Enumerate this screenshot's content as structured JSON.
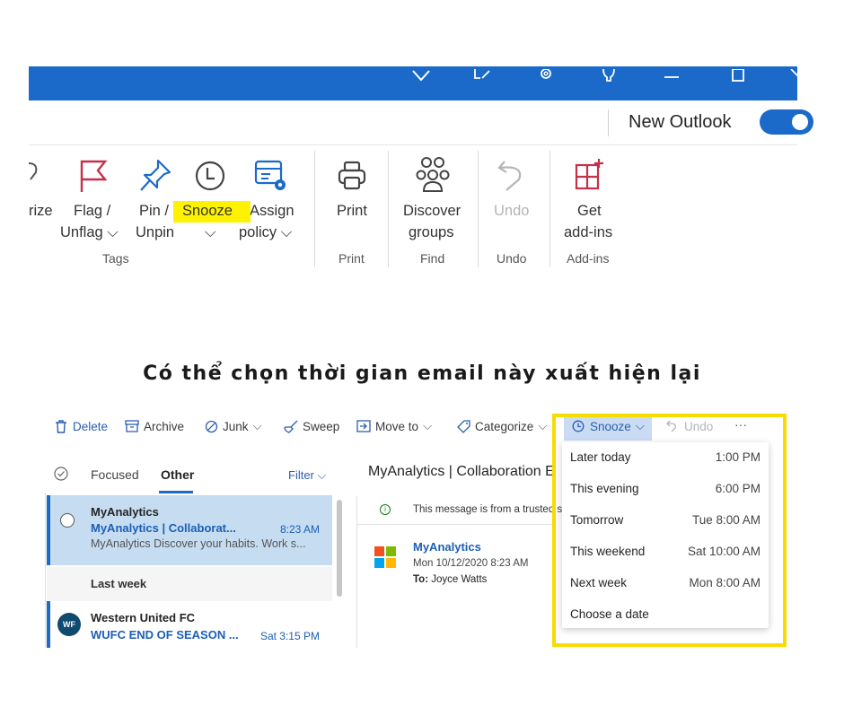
{
  "ribbon": {
    "new_outlook_label": "New Outlook",
    "buttons": {
      "categorize_partial": "rize",
      "flag_line1": "Flag /",
      "flag_line2": "Unflag ⌵",
      "pin_line1": "Pin /",
      "pin_line2": "Unpin",
      "snooze_line1": "Snooze",
      "snooze_line2": "⌵",
      "assign_line1": "Assign",
      "assign_line2": "policy ⌵",
      "print_label": "Print",
      "discover_line1": "Discover",
      "discover_line2": "groups",
      "undo_label": "Undo",
      "get_line1": "Get",
      "get_line2": "add-ins"
    },
    "groups": {
      "tags": "Tags",
      "print": "Print",
      "find": "Find",
      "undo": "Undo",
      "addins": "Add-ins"
    },
    "colors": {
      "accent": "#1b6ac9",
      "flag": "#c4314b",
      "highlight": "#fff200"
    }
  },
  "caption": "Có thể chọn thời gian email này xuất hiện lại",
  "commandbar": {
    "delete": "Delete",
    "archive": "Archive",
    "junk": "Junk",
    "sweep": "Sweep",
    "move_to": "Move to",
    "categorize": "Categorize",
    "snooze": "Snooze",
    "undo": "Undo",
    "more": "···"
  },
  "folders": {
    "focused": "Focused",
    "other": "Other",
    "filter": "Filter"
  },
  "messages": [
    {
      "sender": "MyAnalytics",
      "subject": "MyAnalytics | Collaborat...",
      "time": "8:23 AM",
      "preview": "MyAnalytics Discover your habits. Work s..."
    },
    {
      "sender": "Western United FC",
      "subject": "WUFC END OF SEASON ...",
      "time": "Sat 3:15 PM",
      "avatar": "WF"
    }
  ],
  "last_week_label": "Last week",
  "reading": {
    "header": "MyAnalytics | Collaboration E",
    "trusted": "This message is from a trusted se",
    "sender": "MyAnalytics",
    "date": "Mon 10/12/2020 8:23 AM",
    "to_label": "To:",
    "to_name": "Joyce Watts"
  },
  "snooze_menu": [
    {
      "label": "Later today",
      "time": "1:00 PM"
    },
    {
      "label": "This evening",
      "time": "6:00 PM"
    },
    {
      "label": "Tomorrow",
      "time": "Tue 8:00 AM"
    },
    {
      "label": "This weekend",
      "time": "Sat 10:00 AM"
    },
    {
      "label": "Next week",
      "time": "Mon 8:00 AM"
    },
    {
      "label": "Choose a date",
      "time": ""
    }
  ]
}
